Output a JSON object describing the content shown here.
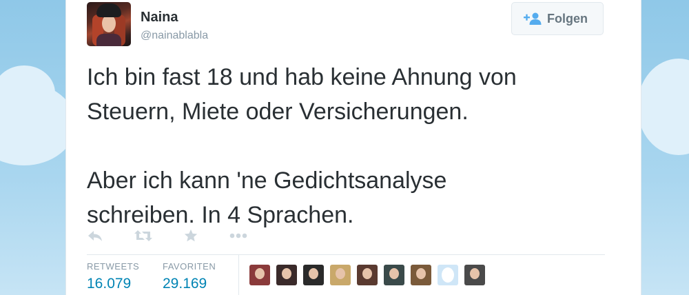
{
  "user": {
    "name": "Naina",
    "handle": "@nainablabla",
    "avatar_icon": "user-avatar-photo"
  },
  "follow_button": {
    "label": "Folgen",
    "icon": "add-user-icon"
  },
  "tweet": {
    "text": "Ich bin fast 18 und hab keine Ahnung von\nSteuern, Miete oder Versicherungen.\n\nAber ich kann 'ne Gedichtsanalyse\nschreiben. In 4 Sprachen."
  },
  "actions": [
    "reply-icon",
    "retweet-icon",
    "favorite-icon",
    "more-icon"
  ],
  "stats": {
    "retweets_label": "RETWEETS",
    "retweets_value": "16.079",
    "favorites_label": "FAVORITEN",
    "favorites_value": "29.169"
  },
  "favoriters": [
    {
      "bg": "#8a3a3a"
    },
    {
      "bg": "#3a2a2a"
    },
    {
      "bg": "#2a2a2a"
    },
    {
      "bg": "#c9a86a"
    },
    {
      "bg": "#5a3a30"
    },
    {
      "bg": "#3a4a4a"
    },
    {
      "bg": "#7a5a3a"
    },
    {
      "bg": "#cfe6f7"
    },
    {
      "bg": "#4a4a4a"
    }
  ],
  "colors": {
    "link": "#0084b4",
    "muted": "#8899a6",
    "text": "#292f33",
    "background": "#a9d6ef"
  }
}
